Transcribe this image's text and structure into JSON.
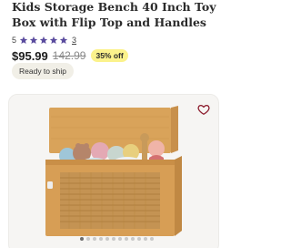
{
  "product": {
    "title": "Kids Storage Bench 40 Inch Toy Box with Flip Top and Handles",
    "rating": "5",
    "review_count": "3",
    "star_count": 5
  },
  "pricing": {
    "price": "$95.99",
    "was_price": "142.99",
    "discount_badge": "35% off"
  },
  "shipping": {
    "badge": "Ready to ship"
  },
  "gallery": {
    "dot_count": 12,
    "active_index": 0
  },
  "colors": {
    "star": "#5a4b9e",
    "heart": "#8b1a2b",
    "discount_bg": "#fbf28c",
    "ready_bg": "#f1efe7"
  },
  "icons": {
    "favorite": "heart-icon",
    "rating_star": "star-icon"
  }
}
